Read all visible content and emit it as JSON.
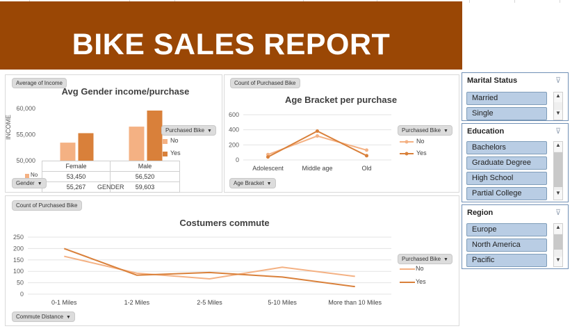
{
  "banner": {
    "title": "BIKE SALES REPORT",
    "color": "#9a4705"
  },
  "colors": {
    "no": "#f4b183",
    "yes": "#d9803a",
    "slicer_fill": "#b9cde4"
  },
  "income_chart": {
    "pill": "Average of Income",
    "title": "Avg Gender income/purchase",
    "ylabel": "INCOME",
    "field_pill": "Purchased Bike",
    "axis_pill": "Gender",
    "table_row_label": "GENDER",
    "legend": [
      "No",
      "Yes"
    ],
    "chart_data": {
      "type": "bar",
      "categories": [
        "Female",
        "Male"
      ],
      "series": [
        {
          "name": "No",
          "values": [
            53450,
            56520
          ]
        },
        {
          "name": "Yes",
          "values": [
            55267,
            59603
          ]
        }
      ],
      "yticks": [
        "60,000",
        "55,000",
        "50,000"
      ],
      "ylim": [
        50000,
        60000
      ]
    },
    "table": {
      "headers": [
        "Female",
        "Male"
      ],
      "rows": [
        {
          "label": "No",
          "values": [
            "53,450",
            "56,520"
          ]
        },
        {
          "label": "Yes",
          "values": [
            "55,267",
            "59,603"
          ]
        }
      ]
    }
  },
  "age_chart": {
    "pill": "Count of Purchased Bike",
    "title": "Age Bracket per purchase",
    "field_pill": "Purchased Bike",
    "axis_pill": "Age Bracket",
    "legend": [
      "No",
      "Yes"
    ],
    "chart_data": {
      "type": "line",
      "categories": [
        "Adolescent",
        "Middle age",
        "Old"
      ],
      "series": [
        {
          "name": "No",
          "values": [
            71,
            318,
            130
          ]
        },
        {
          "name": "Yes",
          "values": [
            39,
            383,
            56
          ]
        }
      ],
      "yticks": [
        "600",
        "400",
        "200",
        "0"
      ],
      "ylim": [
        0,
        600
      ]
    }
  },
  "commute_chart": {
    "pill": "Count of Purchased Bike",
    "title": "Costumers commute",
    "field_pill": "Purchased Bike",
    "axis_pill": "Commute Distance",
    "legend": [
      "No",
      "Yes"
    ],
    "chart_data": {
      "type": "line",
      "categories": [
        "0-1 Miles",
        "1-2 Miles",
        "2-5 Miles",
        "5-10 Miles",
        "More than 10 Miles"
      ],
      "series": [
        {
          "name": "No",
          "values": [
            166,
            92,
            67,
            118,
            78
          ]
        },
        {
          "name": "Yes",
          "values": [
            200,
            83,
            95,
            75,
            33
          ]
        }
      ],
      "yticks": [
        "250",
        "200",
        "150",
        "100",
        "50",
        "0"
      ],
      "ylim": [
        0,
        250
      ]
    }
  },
  "slicers": {
    "marital": {
      "title": "Marital Status",
      "items": [
        "Married",
        "Single"
      ]
    },
    "education": {
      "title": "Education",
      "items": [
        "Bachelors",
        "Graduate Degree",
        "High School",
        "Partial College"
      ]
    },
    "region": {
      "title": "Region",
      "items": [
        "Europe",
        "North America",
        "Pacific"
      ]
    }
  }
}
